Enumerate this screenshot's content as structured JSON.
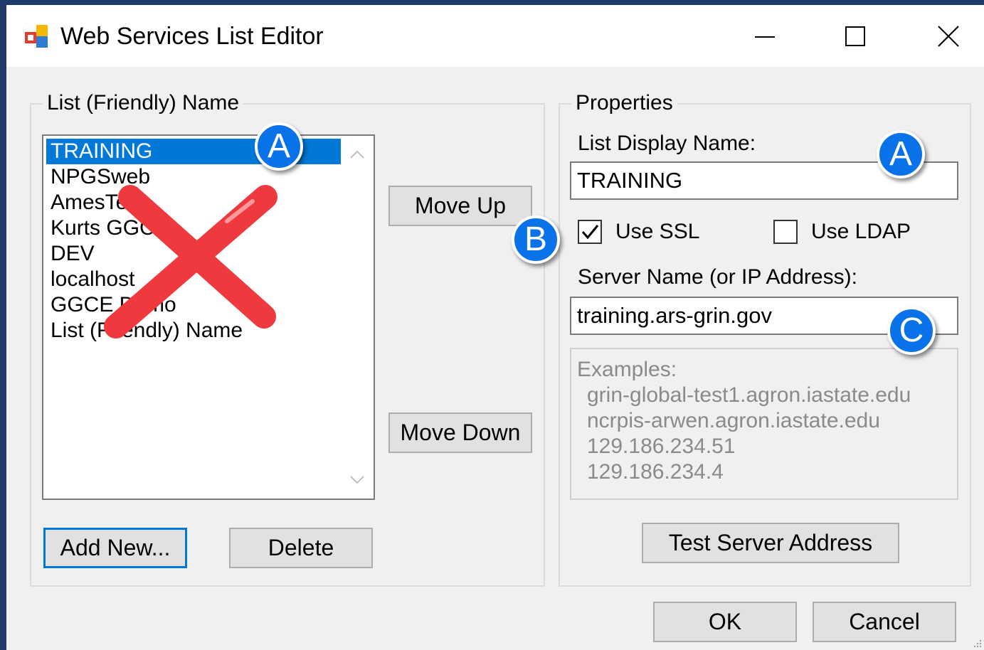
{
  "window": {
    "title": "Web Services List Editor",
    "buttons": {
      "minimize": "minimize",
      "maximize": "maximize",
      "close": "close"
    }
  },
  "list_group": {
    "legend": "List (Friendly) Name",
    "items": [
      "TRAINING",
      "NPGSweb",
      "AmesTest",
      "Kurts GGCE",
      "DEV",
      "localhost",
      "GGCE Demo",
      "List (Friendly) Name"
    ],
    "selected_index": 0,
    "move_up": "Move Up",
    "move_down": "Move Down",
    "add_new": "Add New...",
    "delete": "Delete"
  },
  "properties": {
    "legend": "Properties",
    "display_name_label": "List Display Name:",
    "display_name_value": "TRAINING",
    "use_ssl_label": "Use SSL",
    "use_ssl_checked": true,
    "use_ldap_label": "Use LDAP",
    "use_ldap_checked": false,
    "server_label": "Server Name (or IP Address):",
    "server_value": "training.ars-grin.gov",
    "examples_label": "Examples:",
    "examples": [
      "grin-global-test1.agron.iastate.edu",
      "ncrpis-arwen.agron.iastate.edu",
      "129.186.234.51",
      "129.186.234.4"
    ],
    "test_button": "Test Server Address"
  },
  "footer": {
    "ok": "OK",
    "cancel": "Cancel"
  },
  "annotations": {
    "callout_a1": "A",
    "callout_a2": "A",
    "callout_b": "B",
    "callout_c": "C",
    "callout_color": "#0a72e8",
    "cross_color": "#ee3a3f"
  }
}
